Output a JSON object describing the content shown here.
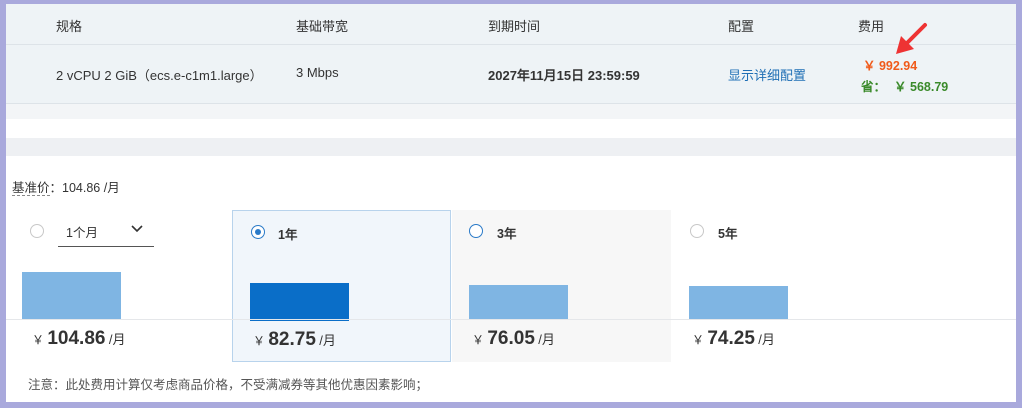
{
  "table": {
    "headers": [
      "规格",
      "基础带宽",
      "到期时间",
      "配置",
      "费用"
    ],
    "row": {
      "spec": "2 vCPU 2 GiB（ecs.e-c1m1.large）",
      "bandwidth": "3 Mbps",
      "expiry": "2027年11月15日 23:59:59",
      "config_link": "显示详细配置",
      "fee_original": "￥ 992.94",
      "fee_save_label": "省：",
      "fee_save_value": "￥ 568.79"
    }
  },
  "base_price": {
    "label": "基准价",
    "value": "：104.86 /月"
  },
  "plans": [
    {
      "label": "1个月",
      "currency": "￥",
      "price": "104.86",
      "unit": "/月",
      "selected": false,
      "bar_level": 1.0
    },
    {
      "label": "1年",
      "currency": "￥",
      "price": "82.75",
      "unit": "/月",
      "selected": true,
      "bar_level": 0.79
    },
    {
      "label": "3年",
      "currency": "￥",
      "price": "76.05",
      "unit": "/月",
      "selected": false,
      "bar_level": 0.73
    },
    {
      "label": "5年",
      "currency": "￥",
      "price": "74.25",
      "unit": "/月",
      "selected": false,
      "bar_level": 0.71
    }
  ],
  "note": "注意：此处费用计算仅考虑商品价格，不受满减券等其他优惠因素影响；",
  "colors": {
    "accent": "#0a6ec8",
    "bar": "#7fb5e3",
    "fee_orange": "#f05a1a",
    "save_green": "#3a8a2a",
    "annotation_arrow": "#ee3333"
  },
  "icons": {
    "dropdown": "chevron-down-icon",
    "annotation": "red-arrow-icon"
  }
}
